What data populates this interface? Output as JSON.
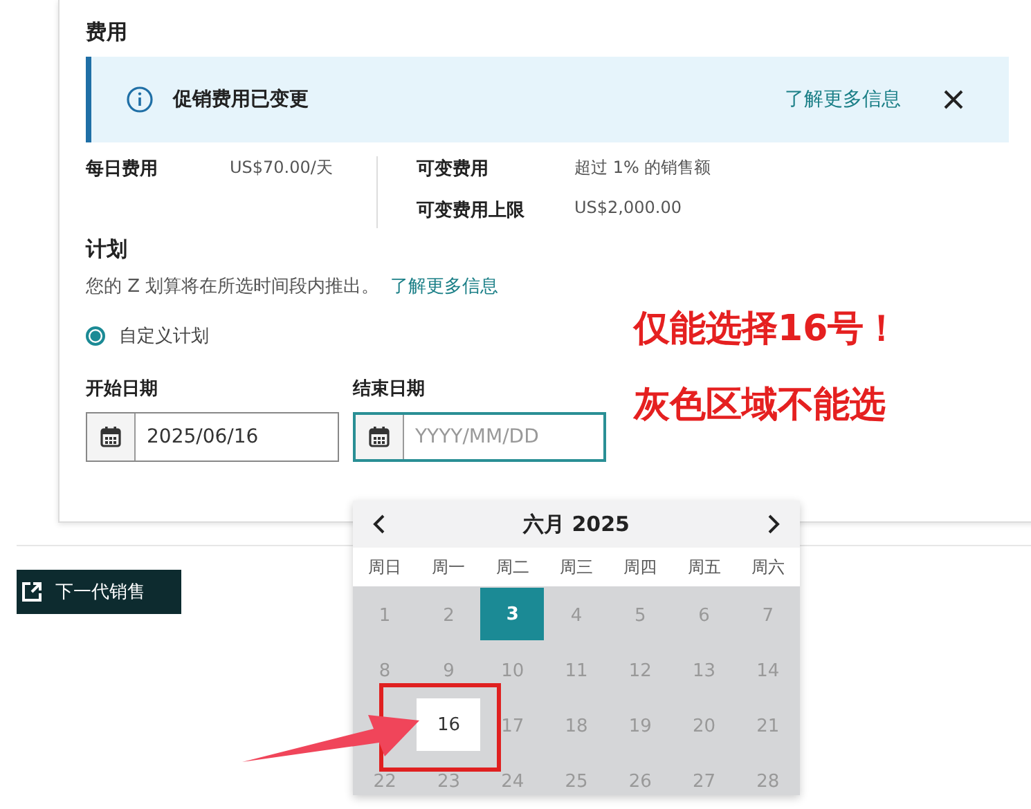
{
  "fees": {
    "title": "费用",
    "notice": {
      "text": "促销费用已变更",
      "link": "了解更多信息"
    },
    "columns": [
      [
        {
          "label": "每日费用",
          "value": "US$70.00/天"
        }
      ],
      [
        {
          "label": "可变费用",
          "value": "超过 1% 的销售额"
        },
        {
          "label": "可变费用上限",
          "value": "US$2,000.00"
        }
      ]
    ]
  },
  "schedule": {
    "title": "计划",
    "description": "您的 Z 划算将在所选时间段内推出。",
    "link": "了解更多信息",
    "options": [
      {
        "label": "自定义计划",
        "selected": true
      }
    ],
    "start_date": {
      "label": "开始日期",
      "value": "2025/06/16",
      "focused": false
    },
    "end_date": {
      "label": "结束日期",
      "placeholder": "YYYY/MM/DD",
      "focused": true
    }
  },
  "side_button": "下一代销售",
  "calendar": {
    "month": "六月 2025",
    "weekdays": [
      "周日",
      "周一",
      "周二",
      "周三",
      "周四",
      "周五",
      "周六"
    ],
    "days": [
      {
        "kind": "day",
        "label": "1",
        "disabled": true,
        "selected": false,
        "highlighted": false
      },
      {
        "kind": "day",
        "label": "2",
        "disabled": true,
        "selected": false,
        "highlighted": false
      },
      {
        "kind": "day",
        "label": "3",
        "disabled": false,
        "selected": true,
        "highlighted": false
      },
      {
        "kind": "day",
        "label": "4",
        "disabled": true,
        "selected": false,
        "highlighted": false
      },
      {
        "kind": "day",
        "label": "5",
        "disabled": true,
        "selected": false,
        "highlighted": false
      },
      {
        "kind": "day",
        "label": "6",
        "disabled": true,
        "selected": false,
        "highlighted": false
      },
      {
        "kind": "day",
        "label": "7",
        "disabled": true,
        "selected": false,
        "highlighted": false
      },
      {
        "kind": "day",
        "label": "8",
        "disabled": true,
        "selected": false,
        "highlighted": false
      },
      {
        "kind": "day",
        "label": "9",
        "disabled": true,
        "selected": false,
        "highlighted": false
      },
      {
        "kind": "day",
        "label": "10",
        "disabled": true,
        "selected": false,
        "highlighted": false
      },
      {
        "kind": "day",
        "label": "11",
        "disabled": true,
        "selected": false,
        "highlighted": false
      },
      {
        "kind": "day",
        "label": "12",
        "disabled": true,
        "selected": false,
        "highlighted": false
      },
      {
        "kind": "day",
        "label": "13",
        "disabled": true,
        "selected": false,
        "highlighted": false
      },
      {
        "kind": "day",
        "label": "14",
        "disabled": true,
        "selected": false,
        "highlighted": false
      },
      {
        "kind": "covered"
      },
      {
        "kind": "day",
        "label": "16",
        "disabled": false,
        "selected": false,
        "highlighted": true
      },
      {
        "kind": "day",
        "label": "17",
        "disabled": true,
        "selected": false,
        "highlighted": false
      },
      {
        "kind": "day",
        "label": "18",
        "disabled": true,
        "selected": false,
        "highlighted": false
      },
      {
        "kind": "day",
        "label": "19",
        "disabled": true,
        "selected": false,
        "highlighted": false
      },
      {
        "kind": "day",
        "label": "20",
        "disabled": true,
        "selected": false,
        "highlighted": false
      },
      {
        "kind": "day",
        "label": "21",
        "disabled": true,
        "selected": false,
        "highlighted": false
      },
      {
        "kind": "day",
        "label": "22",
        "disabled": true,
        "selected": false,
        "highlighted": false
      },
      {
        "kind": "day",
        "label": "23",
        "disabled": true,
        "selected": false,
        "highlighted": false
      },
      {
        "kind": "day",
        "label": "24",
        "disabled": true,
        "selected": false,
        "highlighted": false
      },
      {
        "kind": "day",
        "label": "25",
        "disabled": true,
        "selected": false,
        "highlighted": false
      },
      {
        "kind": "day",
        "label": "26",
        "disabled": true,
        "selected": false,
        "highlighted": false
      },
      {
        "kind": "day",
        "label": "27",
        "disabled": true,
        "selected": false,
        "highlighted": false
      },
      {
        "kind": "day",
        "label": "28",
        "disabled": true,
        "selected": false,
        "highlighted": false
      }
    ]
  },
  "annotations": [
    "仅能选择16号！",
    "灰色区域不能选"
  ]
}
